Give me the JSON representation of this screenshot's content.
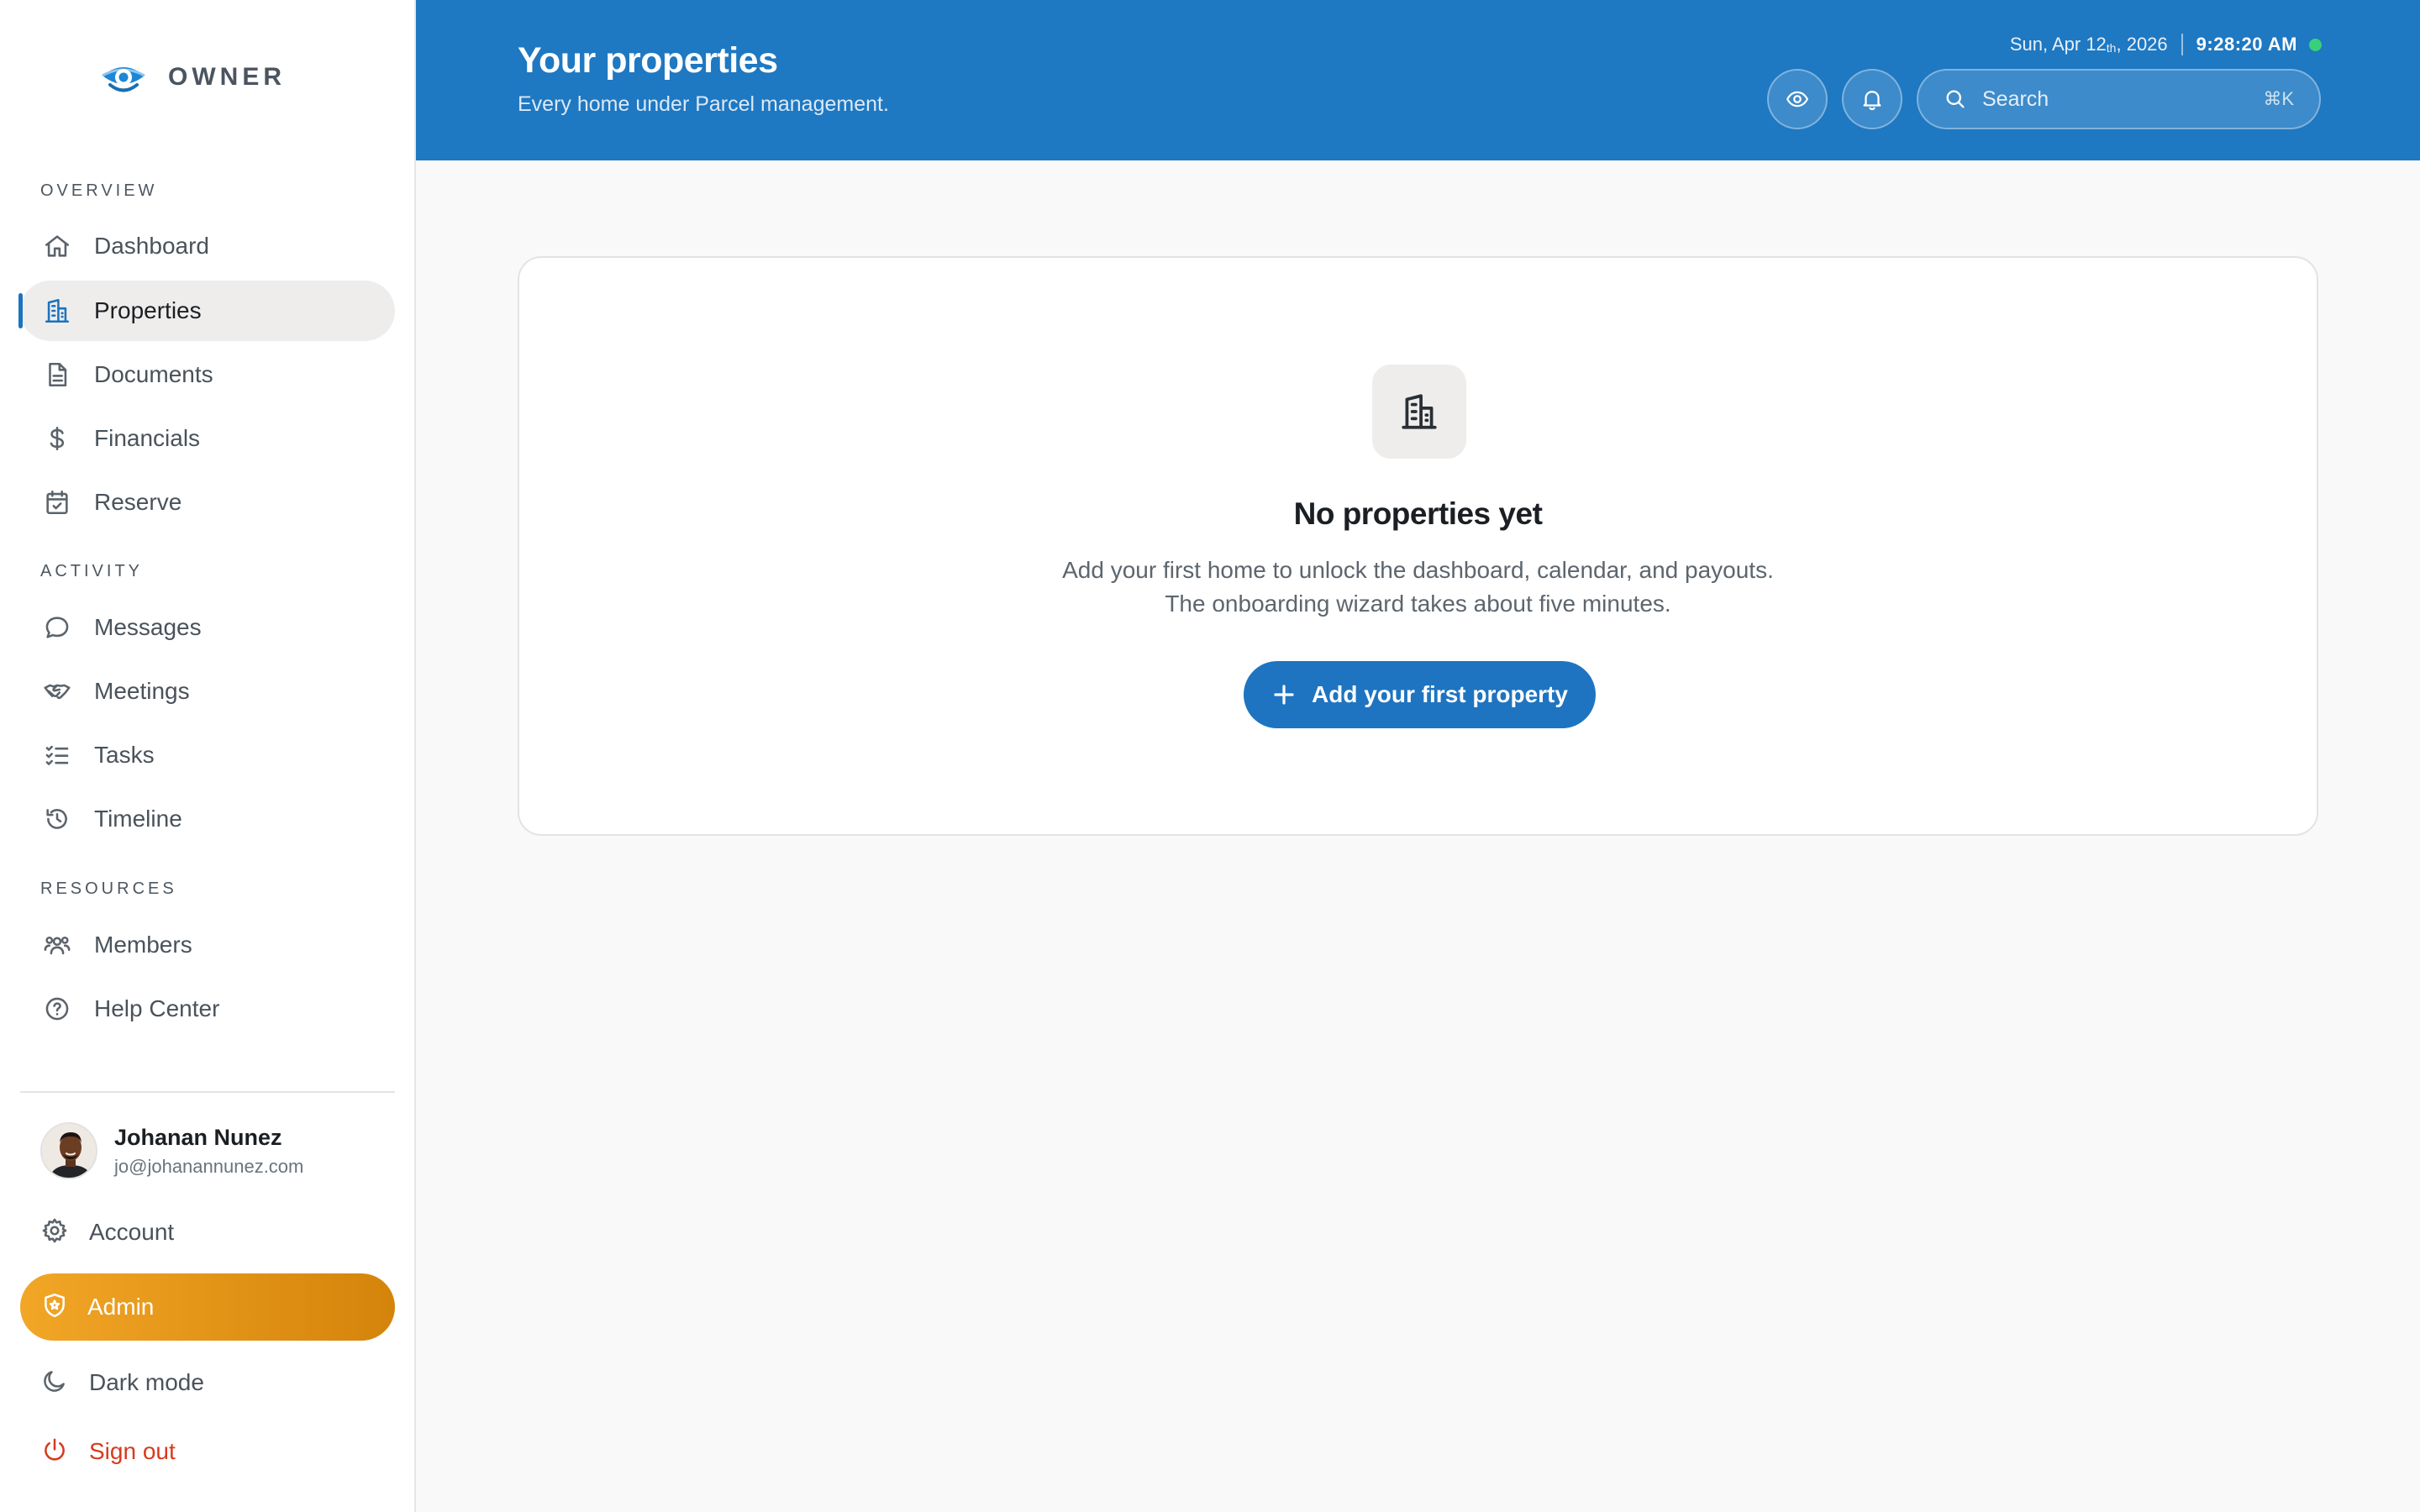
{
  "brand": {
    "name": "OWNER",
    "logo_icon": "eye-logo-icon"
  },
  "sidebar": {
    "sections": [
      {
        "title": "OVERVIEW",
        "items": [
          {
            "label": "Dashboard",
            "icon": "home-icon"
          },
          {
            "label": "Properties",
            "icon": "building-icon",
            "active": true
          },
          {
            "label": "Documents",
            "icon": "document-icon"
          },
          {
            "label": "Financials",
            "icon": "dollar-icon"
          },
          {
            "label": "Reserve",
            "icon": "calendar-check-icon"
          }
        ]
      },
      {
        "title": "ACTIVITY",
        "items": [
          {
            "label": "Messages",
            "icon": "chat-bubble-icon"
          },
          {
            "label": "Meetings",
            "icon": "handshake-icon"
          },
          {
            "label": "Tasks",
            "icon": "checklist-icon"
          },
          {
            "label": "Timeline",
            "icon": "history-icon"
          }
        ]
      },
      {
        "title": "RESOURCES",
        "items": [
          {
            "label": "Members",
            "icon": "people-icon"
          },
          {
            "label": "Help Center",
            "icon": "help-circle-icon"
          }
        ]
      }
    ],
    "user": {
      "name": "Johanan Nunez",
      "email": "jo@johanannunez.com"
    },
    "bottom": {
      "account": "Account",
      "admin": "Admin",
      "dark_mode": "Dark mode",
      "sign_out": "Sign out"
    }
  },
  "header": {
    "title": "Your properties",
    "subtitle": "Every home under Parcel management.",
    "date_prefix": "Sun, Apr 12",
    "date_suffix": "th",
    "date_year": ", 2026",
    "time": "9:28:20 AM",
    "search_placeholder": "Search",
    "search_shortcut": "⌘K"
  },
  "empty_state": {
    "title": "No properties yet",
    "line1": "Add your first home to unlock the dashboard, calendar, and payouts.",
    "line2": "The onboarding wizard takes about five minutes.",
    "cta": "Add your first property"
  },
  "colors": {
    "brand_blue": "#1e78c2",
    "admin_orange": "#f2a626",
    "danger": "#d9391c",
    "online": "#38d17a"
  }
}
